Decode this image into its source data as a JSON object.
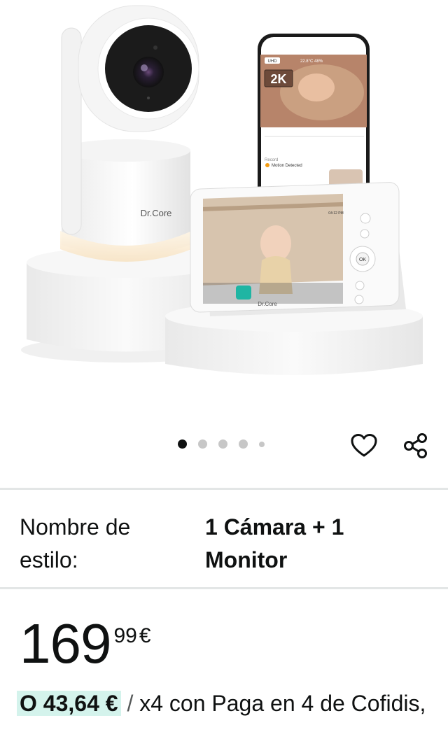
{
  "image": {
    "camera_brand": "Dr.Core",
    "phone_resolution_badge": "2K",
    "phone_uhd_badge": "UHD",
    "phone_status": "22.8°C  48%",
    "phone_event_header": "Record",
    "phone_event": "Motion Detected",
    "monitor_brand": "Dr.Core",
    "monitor_ok_label": "OK",
    "monitor_time": "04:12 PM"
  },
  "carousel": {
    "total_dots": 5,
    "active_index": 0
  },
  "actions": {
    "wishlist_icon": "heart-icon",
    "share_icon": "share-icon"
  },
  "style": {
    "label": "Nombre de estilo:",
    "value": "1 Cámara + 1 Monitor"
  },
  "price": {
    "whole": "169",
    "fraction": "99",
    "currency": "€"
  },
  "installment": {
    "amount": "O 43,64 €",
    "separator": "/",
    "text": "x4 con Paga en 4 de Cofidis,"
  },
  "colors": {
    "installment_highlight": "#d4f3ec",
    "divider": "#e3e6e6"
  }
}
